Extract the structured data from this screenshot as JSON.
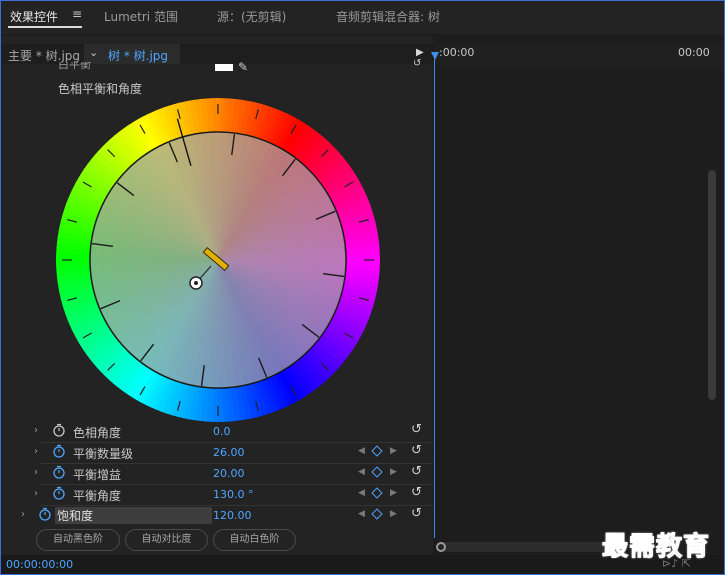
{
  "tabs": {
    "effects": "效果控件",
    "menu_icon": "≡",
    "lumetri": "Lumetri 范围",
    "source": "源：(无剪辑)",
    "mixer": "音频剪辑混合器: 树"
  },
  "source_bar": {
    "main": "主要 * 树.jpg",
    "chevron": "⌄",
    "clip": "树 * 树.jpg",
    "play": "▶"
  },
  "white_balance": {
    "label": "白平衡",
    "picker_icon": "✎",
    "reset_icon": "↺"
  },
  "hue_balance": {
    "title": "色相平衡和角度"
  },
  "params": [
    {
      "label": "色相角度",
      "value": "0.0"
    },
    {
      "label": "平衡数量级",
      "value": "26.00"
    },
    {
      "label": "平衡增益",
      "value": "20.00"
    },
    {
      "label": "平衡角度",
      "value": "130.0 °"
    },
    {
      "label": "饱和度",
      "value": "120.00"
    }
  ],
  "buttons": {
    "auto_black": "自动黑色阶",
    "auto_contrast": "自动对比度",
    "auto_white": "自动白色阶"
  },
  "timeline": {
    "start": ":00:00",
    "end": "00:00"
  },
  "status": {
    "timecode": "00:00:00:00",
    "icons": "⊳♪  ⇱"
  },
  "watermark": "最需教育",
  "colors": {
    "accent": "#4ea6ff",
    "playhead": "#3b8ee8",
    "handle": "#e0b000"
  },
  "icons": {
    "arrow": "›",
    "stopwatch": "stopwatch-icon",
    "reset": "↺",
    "prev": "◀",
    "next": "▶",
    "kf_tl": "▶"
  }
}
